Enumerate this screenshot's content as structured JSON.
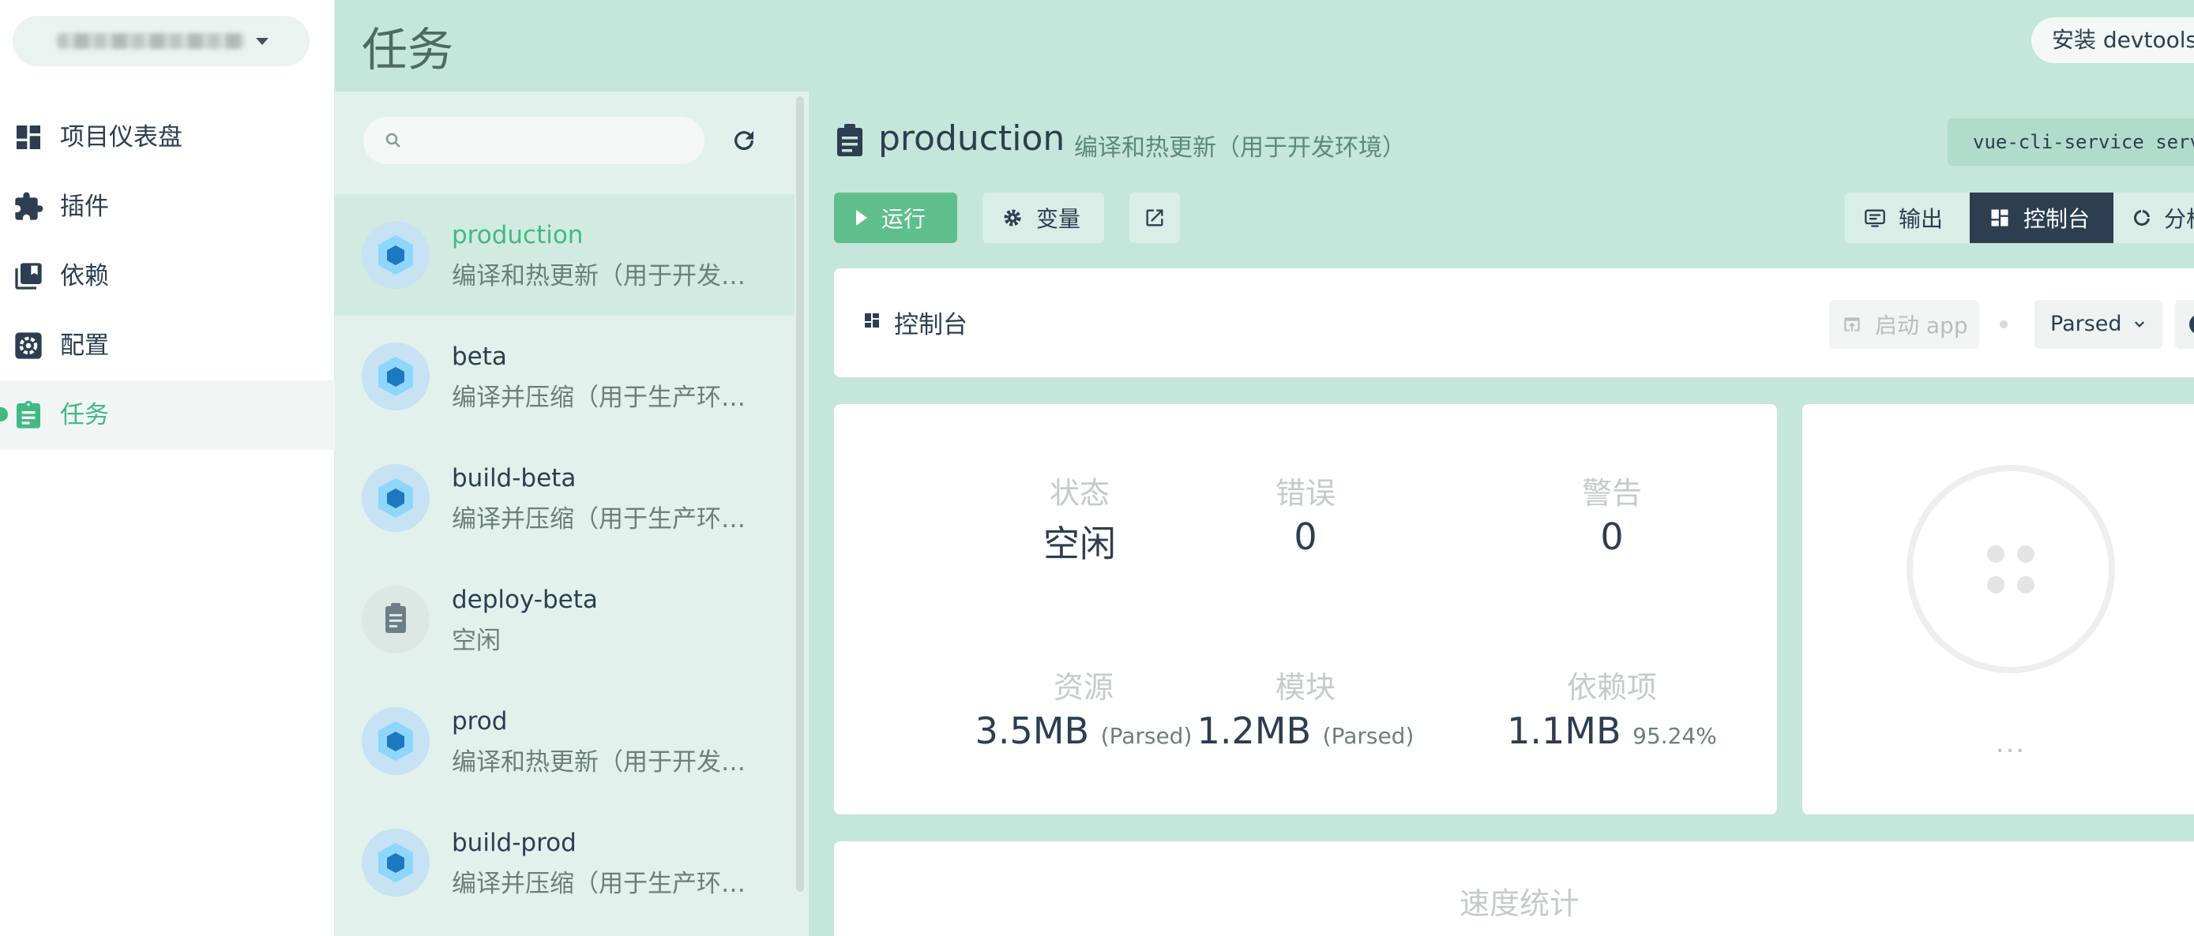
{
  "nav": {
    "items": [
      {
        "label": "项目仪表盘",
        "icon": "dashboard-icon"
      },
      {
        "label": "插件",
        "icon": "puzzle-icon"
      },
      {
        "label": "依赖",
        "icon": "library-icon"
      },
      {
        "label": "配置",
        "icon": "gear-icon"
      },
      {
        "label": "任务",
        "icon": "clipboard-icon",
        "active": true
      }
    ]
  },
  "header": {
    "title": "任务",
    "devtools_label": "安装 devtools"
  },
  "tasklist": {
    "search_placeholder": "",
    "tasks": [
      {
        "name": "production",
        "desc": "编译和热更新（用于开发…",
        "icon": "webpack-icon",
        "selected": true
      },
      {
        "name": "beta",
        "desc": "编译并压缩（用于生产环…",
        "icon": "webpack-icon"
      },
      {
        "name": "build-beta",
        "desc": "编译并压缩（用于生产环…",
        "icon": "webpack-icon"
      },
      {
        "name": "deploy-beta",
        "desc": "空闲",
        "icon": "clipboard-icon"
      },
      {
        "name": "prod",
        "desc": "编译和热更新（用于开发…",
        "icon": "webpack-icon"
      },
      {
        "name": "build-prod",
        "desc": "编译并压缩（用于生产环…",
        "icon": "webpack-icon"
      }
    ]
  },
  "task": {
    "title": "production",
    "subtitle": "编译和热更新（用于开发环境）",
    "command": "vue-cli-service serve",
    "run_label": "运行",
    "vars_label": "变量",
    "tabs": {
      "output": "输出",
      "console": "控制台",
      "analyzer": "分析"
    }
  },
  "console": {
    "title": "控制台",
    "launch_label": "启动 app",
    "parsed_value": "Parsed"
  },
  "stats": {
    "status_label": "状态",
    "status_value": "空闲",
    "errors_label": "错误",
    "errors_value": "0",
    "warnings_label": "警告",
    "warnings_value": "0",
    "assets_label": "资源",
    "assets_value": "3.5MB",
    "assets_suffix": "(Parsed)",
    "modules_label": "模块",
    "modules_value": "1.2MB",
    "modules_suffix": "(Parsed)",
    "deps_label": "依赖项",
    "deps_value": "1.1MB",
    "deps_suffix": "95.24%"
  },
  "donut": {
    "ellipsis": "..."
  },
  "speed": {
    "title": "速度统计"
  },
  "colors": {
    "accent": "#42b983",
    "header_bg": "#c5e6da",
    "panel_bg": "#e2f1ec",
    "dark": "#2c3e50",
    "webpack_blue": "#8ed6fb"
  }
}
